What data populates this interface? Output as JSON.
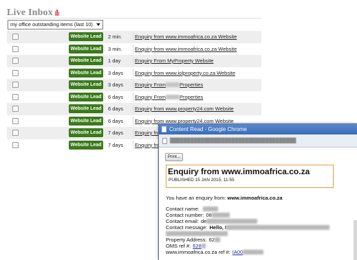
{
  "inbox": {
    "title": "Live Inbox",
    "filter": "my office outstanding items (last 10)",
    "rows": [
      {
        "badge": "Website Lead",
        "age": "2 min.",
        "subject": "Enquiry from www.immoafrica.co.za Website",
        "blur": false
      },
      {
        "badge": "Website Lead",
        "age": "3 min.",
        "subject": "Enquiry from www.immoafrica.co.za Website",
        "blur": false
      },
      {
        "badge": "Website Lead",
        "age": "1 day",
        "subject": "Enquiry From MyProperty Website",
        "blur": false
      },
      {
        "badge": "Website Lead",
        "age": "3 days",
        "subject": "Enquiry from www.iolproperty.co.za Website",
        "blur": false
      },
      {
        "badge": "Website Lead",
        "age": "3 days",
        "subject_a": "Enquiry From",
        "subject_b": "Properties",
        "blur": true
      },
      {
        "badge": "Website Lead",
        "age": "6 days",
        "subject_a": "Enquiry From",
        "subject_b": "Properties",
        "blur": true
      },
      {
        "badge": "Website Lead",
        "age": "6 days",
        "subject": "Enquiry from www.property24.com Website",
        "blur": false
      },
      {
        "badge": "Website Lead",
        "age": "6 days",
        "subject": "Enquiry from www.property24.com Website",
        "blur": false
      },
      {
        "badge": "Website Lead",
        "age": "7 days",
        "subject": "Enquiry from www.",
        "blur": false
      },
      {
        "badge": "Website Lead",
        "age": "7 days",
        "subject": "Enquiry from",
        "blur": false
      }
    ]
  },
  "popup": {
    "window_title": "Content Read - Google Chrome",
    "print_label": "Print...",
    "heading": "Enquiry from www.immoafrica.co.za",
    "published": "PUBLISHED 15 JAN 2015, 11:55",
    "intro_prefix": "You have an enquiry from:",
    "intro_site": "www.immoafrica.co.za",
    "fields": {
      "contact_name_label": "Contact name:",
      "contact_number_label": "Contact number:",
      "contact_number_value": "08",
      "contact_email_label": "Contact email:",
      "contact_email_value": "de",
      "contact_message_label": "Contact message:",
      "contact_message_value": "Hello, I",
      "property_address_label": "Property Address:",
      "property_address_value": "62",
      "oms_ref_label": "OMS ref #:",
      "oms_ref_value": "628",
      "site_ref_label": "www.immoafrica.co.za ref #:",
      "site_ref_value": "IA00"
    }
  }
}
